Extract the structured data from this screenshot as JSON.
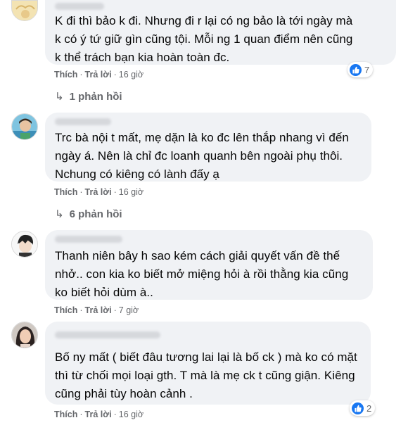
{
  "comments": [
    {
      "text_lines": [
        "K đi thì bảo k đi. Nhưng đi r lại có ng bảo là tới ngày mà",
        "k có ý tứ giữ gìn cũng tội. Mỗi ng 1 quan điểm nên cũng",
        "k thể trách bạn kia hoàn toàn đc."
      ],
      "like_label": "Thích",
      "reply_label": "Trả lời",
      "time": "16 giờ",
      "reaction_count": "7",
      "replies_label": "1 phản hồi"
    },
    {
      "text_lines": [
        "Trc bà nội t mất, mẹ dặn là ko đc lên thắp nhang vì đến",
        "ngày á. Nên là chỉ đc loanh quanh bên ngoài phụ thôi.",
        "Nchung có kiêng có lành đấy ạ"
      ],
      "like_label": "Thích",
      "reply_label": "Trả lời",
      "time": "16 giờ",
      "replies_label": "6 phản hồi"
    },
    {
      "text_lines": [
        "Thanh niên bây h sao kém cách giải quyết vấn đề thế",
        "nhở.. con kia ko biết mở miệng hỏi à rồi thằng kia cũng",
        "ko biết hỏi dùm à.."
      ],
      "like_label": "Thích",
      "reply_label": "Trả lời",
      "time": "7 giờ"
    },
    {
      "text_lines": [
        "Bố ny mất ( biết đâu tương lai lại là bố ck ) mà ko có mặt",
        "thì từ chối mọi loại gth. T mà là mẹ ck t cũng giận. Kiêng",
        "cũng phải tùy hoàn cảnh ."
      ],
      "like_label": "Thích",
      "reply_label": "Trả lời",
      "time": "16 giờ",
      "reaction_count": "2"
    }
  ],
  "colors": {
    "bubble": "#f0f2f5",
    "meta_text": "#65676b",
    "like_blue": "#1877f2"
  },
  "icons": [
    "reply-arrow-icon",
    "like-reaction-icon"
  ]
}
